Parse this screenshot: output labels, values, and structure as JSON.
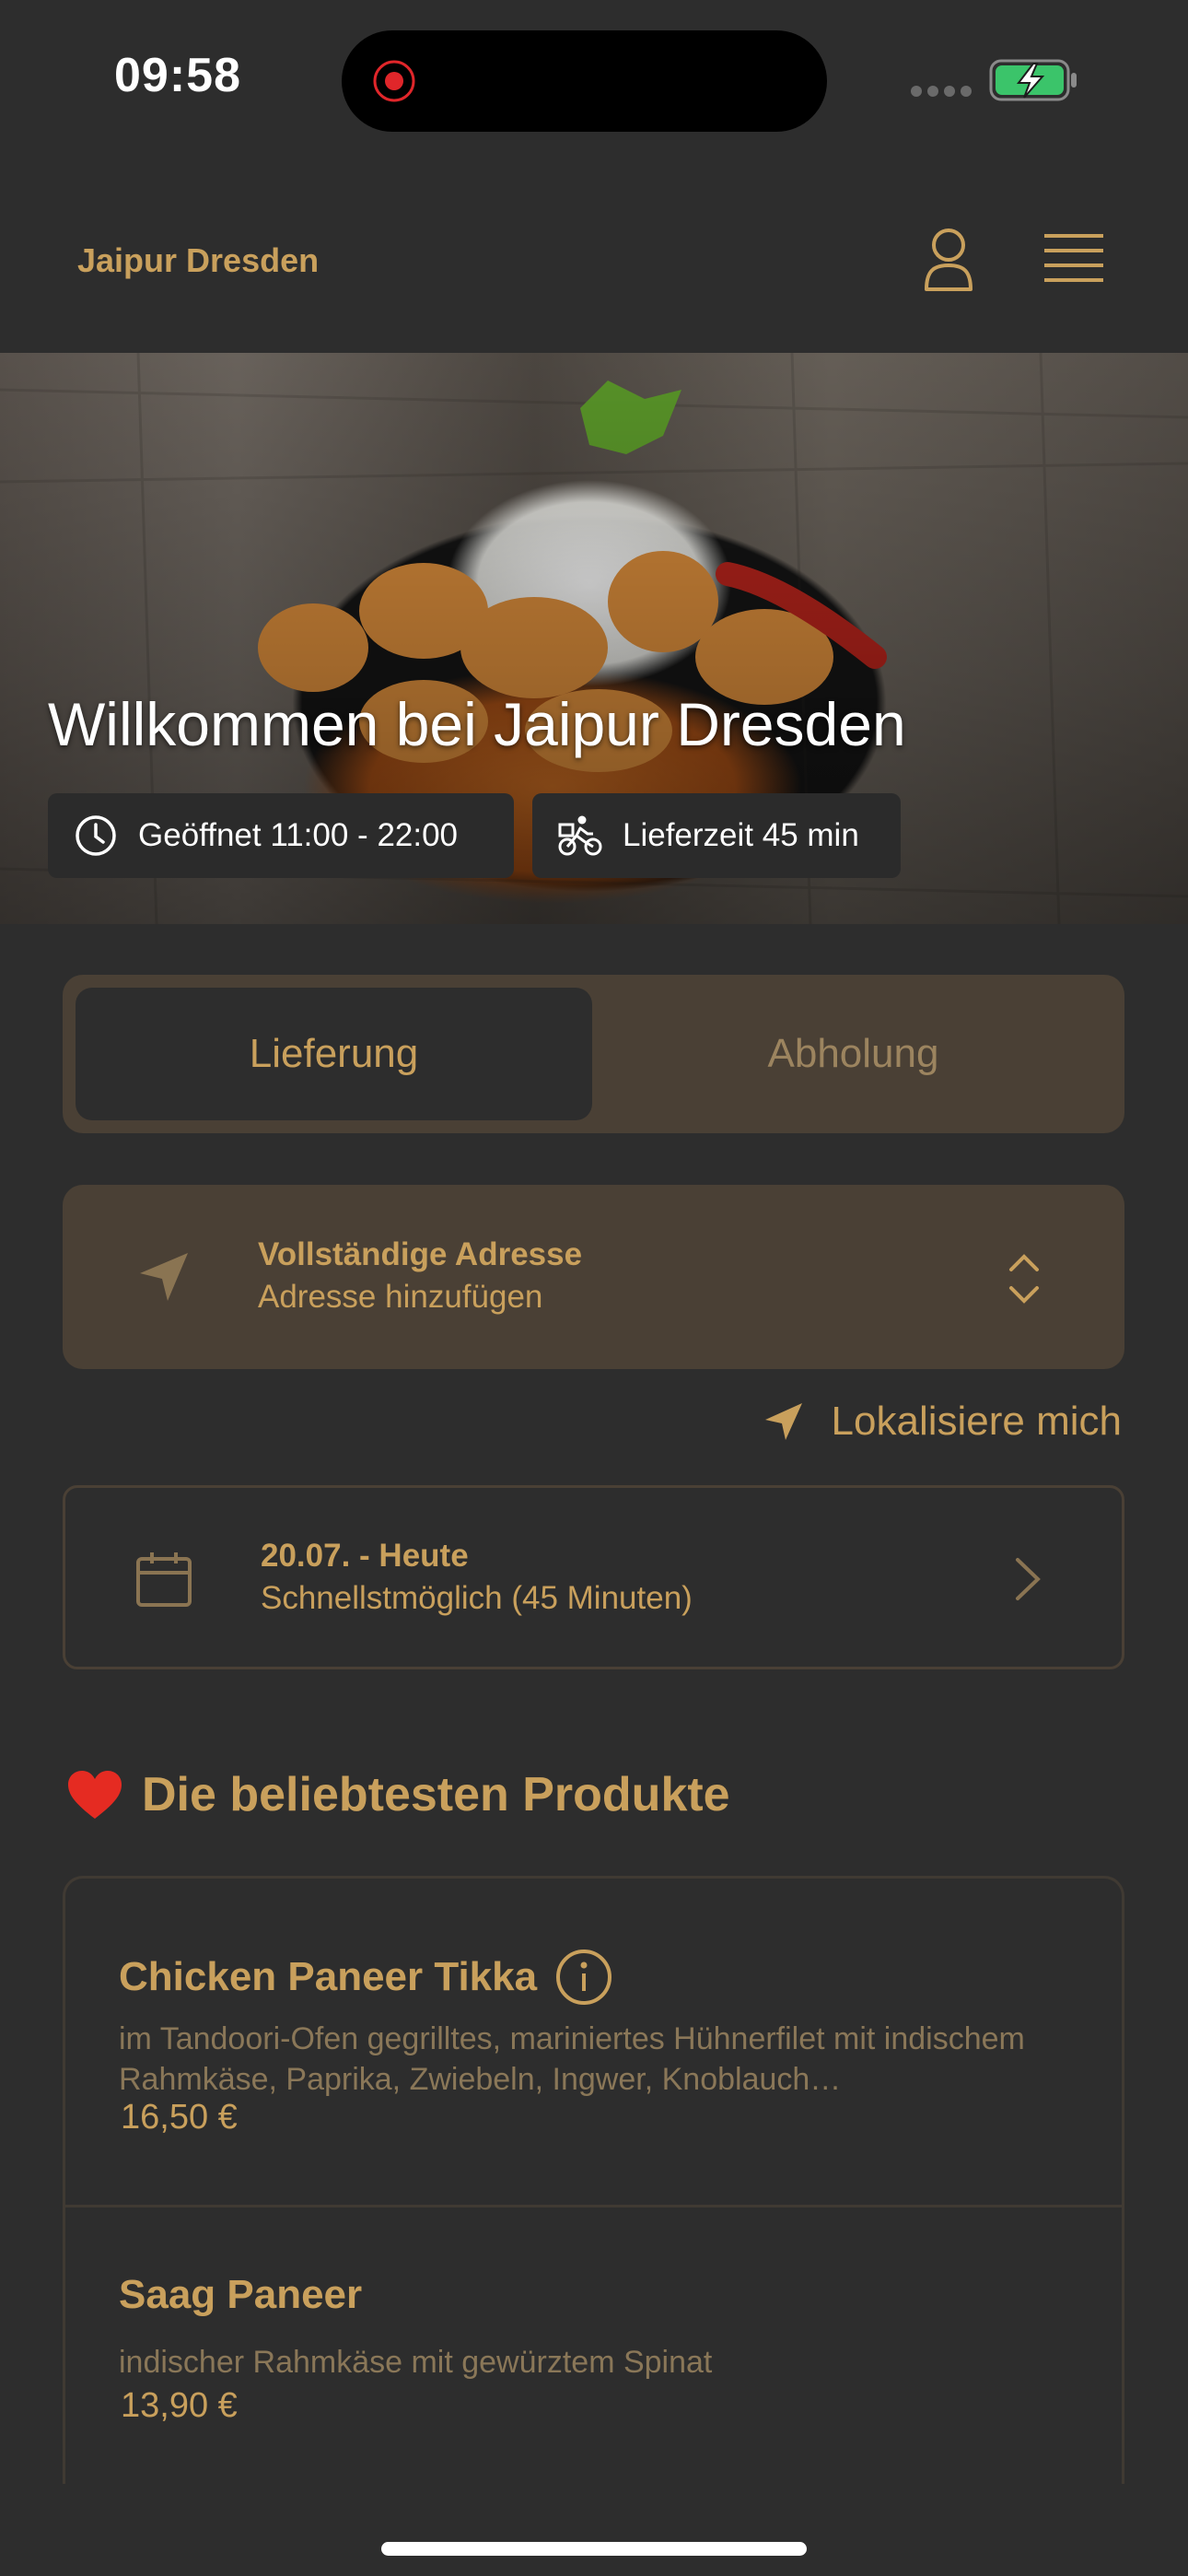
{
  "status_bar": {
    "time": "09:58"
  },
  "header": {
    "brand": "Jaipur Dresden"
  },
  "hero": {
    "title": "Willkommen bei Jaipur Dresden",
    "opening_hours": "Geöffnet 11:00 - 22:00",
    "delivery_time": "Lieferzeit 45 min"
  },
  "tabs": {
    "delivery": "Lieferung",
    "pickup": "Abholung",
    "active": "delivery"
  },
  "address": {
    "title": "Vollständige Adresse",
    "subtitle": "Adresse hinzufügen"
  },
  "locate": {
    "label": "Lokalisiere mich"
  },
  "schedule": {
    "date": "20.07. - Heute",
    "time": "Schnellstmöglich (45 Minuten)"
  },
  "popular": {
    "title": "Die beliebtesten Produkte",
    "items": [
      {
        "name": "Chicken Paneer Tikka",
        "description": "im Tandoori-Ofen gegrilltes, mariniertes Hühnerfilet mit indischem Rahmkäse, Paprika, Zwiebeln, Ingwer, Knoblauch…",
        "price": "16,50 €"
      },
      {
        "name": "Saag Paneer",
        "description": "indischer Rahmkäse mit gewürztem Spinat",
        "price": "13,90 €"
      }
    ]
  },
  "colors": {
    "accent": "#c9a05c",
    "background": "#2d2d2d",
    "panel": "#4a4035"
  }
}
